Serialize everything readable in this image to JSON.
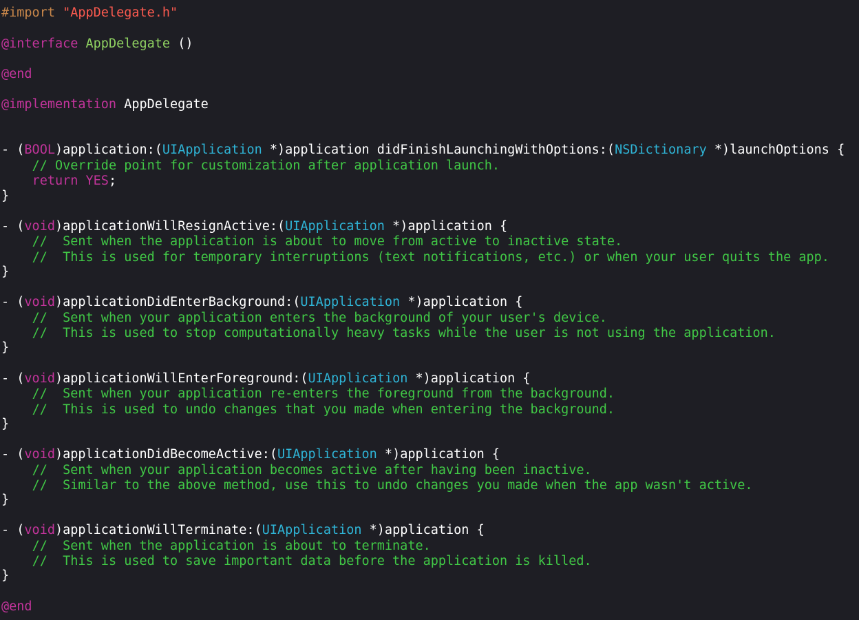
{
  "editor": {
    "colors": {
      "background": "#1e1e24",
      "plain": "#ffffff",
      "directive": "#c9874a",
      "string": "#fc5a4f",
      "keyword": "#c2349b",
      "class": "#8fd161",
      "type": "#2fb4d6",
      "comment": "#41c846"
    },
    "lines": [
      [
        [
          "directive",
          "#import "
        ],
        [
          "string",
          "\"AppDelegate.h\""
        ]
      ],
      [
        [
          "keyword",
          "@interface"
        ],
        [
          "plain",
          " "
        ],
        [
          "class",
          "AppDelegate"
        ],
        [
          "plain",
          " ()"
        ]
      ],
      [
        [
          "keyword",
          "@end"
        ]
      ],
      [
        [
          "keyword",
          "@implementation"
        ],
        [
          "plain",
          " AppDelegate"
        ]
      ],
      [
        [
          "plain",
          "- ("
        ],
        [
          "keyword",
          "BOOL"
        ],
        [
          "plain",
          ")application:("
        ],
        [
          "type",
          "UIApplication"
        ],
        [
          "plain",
          " *)application didFinishLaunchingWithOptions:("
        ],
        [
          "type",
          "NSDictionary"
        ],
        [
          "plain",
          " *)launchOptions {"
        ]
      ],
      [
        [
          "plain",
          "    "
        ],
        [
          "comment",
          "// Override point for customization after application launch."
        ]
      ],
      [
        [
          "plain",
          "    "
        ],
        [
          "keyword",
          "return"
        ],
        [
          "plain",
          " "
        ],
        [
          "keyword",
          "YES"
        ],
        [
          "plain",
          ";"
        ]
      ],
      [
        [
          "plain",
          "}"
        ]
      ],
      [
        [
          "plain",
          "- ("
        ],
        [
          "keyword",
          "void"
        ],
        [
          "plain",
          ")applicationWillResignActive:("
        ],
        [
          "type",
          "UIApplication"
        ],
        [
          "plain",
          " *)application {"
        ]
      ],
      [
        [
          "plain",
          "    "
        ],
        [
          "comment",
          "//  Sent when the application is about to move from active to inactive state."
        ]
      ],
      [
        [
          "plain",
          "    "
        ],
        [
          "comment",
          "//  This is used for temporary interruptions (text notifications, etc.) or when your user quits the app."
        ]
      ],
      [
        [
          "plain",
          "}"
        ]
      ],
      [
        [
          "plain",
          "- ("
        ],
        [
          "keyword",
          "void"
        ],
        [
          "plain",
          ")applicationDidEnterBackground:("
        ],
        [
          "type",
          "UIApplication"
        ],
        [
          "plain",
          " *)application {"
        ]
      ],
      [
        [
          "plain",
          "    "
        ],
        [
          "comment",
          "//  Sent when your application enters the background of your user's device."
        ]
      ],
      [
        [
          "plain",
          "    "
        ],
        [
          "comment",
          "//  This is used to stop computationally heavy tasks while the user is not using the application."
        ]
      ],
      [
        [
          "plain",
          "}"
        ]
      ],
      [
        [
          "plain",
          "- ("
        ],
        [
          "keyword",
          "void"
        ],
        [
          "plain",
          ")applicationWillEnterForeground:("
        ],
        [
          "type",
          "UIApplication"
        ],
        [
          "plain",
          " *)application {"
        ]
      ],
      [
        [
          "plain",
          "    "
        ],
        [
          "comment",
          "//  Sent when your application re-enters the foreground from the background."
        ]
      ],
      [
        [
          "plain",
          "    "
        ],
        [
          "comment",
          "//  This is used to undo changes that you made when entering the background."
        ]
      ],
      [
        [
          "plain",
          "}"
        ]
      ],
      [
        [
          "plain",
          "- ("
        ],
        [
          "keyword",
          "void"
        ],
        [
          "plain",
          ")applicationDidBecomeActive:("
        ],
        [
          "type",
          "UIApplication"
        ],
        [
          "plain",
          " *)application {"
        ]
      ],
      [
        [
          "plain",
          "    "
        ],
        [
          "comment",
          "//  Sent when your application becomes active after having been inactive."
        ]
      ],
      [
        [
          "plain",
          "    "
        ],
        [
          "comment",
          "//  Similar to the above method, use this to undo changes you made when the app wasn't active."
        ]
      ],
      [
        [
          "plain",
          "}"
        ]
      ],
      [
        [
          "plain",
          "- ("
        ],
        [
          "keyword",
          "void"
        ],
        [
          "plain",
          ")applicationWillTerminate:("
        ],
        [
          "type",
          "UIApplication"
        ],
        [
          "plain",
          " *)application {"
        ]
      ],
      [
        [
          "plain",
          "    "
        ],
        [
          "comment",
          "//  Sent when the application is about to terminate."
        ]
      ],
      [
        [
          "plain",
          "    "
        ],
        [
          "comment",
          "//  This is used to save important data before the application is killed."
        ]
      ],
      [
        [
          "plain",
          "}"
        ]
      ],
      [
        [
          "keyword",
          "@end"
        ]
      ]
    ]
  }
}
